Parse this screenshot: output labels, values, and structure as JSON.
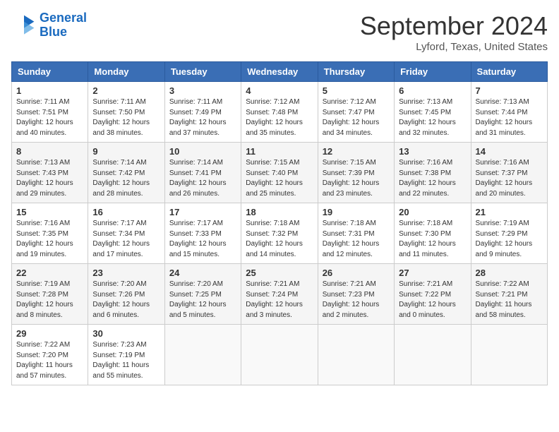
{
  "header": {
    "logo_line1": "General",
    "logo_line2": "Blue",
    "month": "September 2024",
    "location": "Lyford, Texas, United States"
  },
  "weekdays": [
    "Sunday",
    "Monday",
    "Tuesday",
    "Wednesday",
    "Thursday",
    "Friday",
    "Saturday"
  ],
  "weeks": [
    [
      {
        "day": "1",
        "info": "Sunrise: 7:11 AM\nSunset: 7:51 PM\nDaylight: 12 hours\nand 40 minutes."
      },
      {
        "day": "2",
        "info": "Sunrise: 7:11 AM\nSunset: 7:50 PM\nDaylight: 12 hours\nand 38 minutes."
      },
      {
        "day": "3",
        "info": "Sunrise: 7:11 AM\nSunset: 7:49 PM\nDaylight: 12 hours\nand 37 minutes."
      },
      {
        "day": "4",
        "info": "Sunrise: 7:12 AM\nSunset: 7:48 PM\nDaylight: 12 hours\nand 35 minutes."
      },
      {
        "day": "5",
        "info": "Sunrise: 7:12 AM\nSunset: 7:47 PM\nDaylight: 12 hours\nand 34 minutes."
      },
      {
        "day": "6",
        "info": "Sunrise: 7:13 AM\nSunset: 7:45 PM\nDaylight: 12 hours\nand 32 minutes."
      },
      {
        "day": "7",
        "info": "Sunrise: 7:13 AM\nSunset: 7:44 PM\nDaylight: 12 hours\nand 31 minutes."
      }
    ],
    [
      {
        "day": "8",
        "info": "Sunrise: 7:13 AM\nSunset: 7:43 PM\nDaylight: 12 hours\nand 29 minutes."
      },
      {
        "day": "9",
        "info": "Sunrise: 7:14 AM\nSunset: 7:42 PM\nDaylight: 12 hours\nand 28 minutes."
      },
      {
        "day": "10",
        "info": "Sunrise: 7:14 AM\nSunset: 7:41 PM\nDaylight: 12 hours\nand 26 minutes."
      },
      {
        "day": "11",
        "info": "Sunrise: 7:15 AM\nSunset: 7:40 PM\nDaylight: 12 hours\nand 25 minutes."
      },
      {
        "day": "12",
        "info": "Sunrise: 7:15 AM\nSunset: 7:39 PM\nDaylight: 12 hours\nand 23 minutes."
      },
      {
        "day": "13",
        "info": "Sunrise: 7:16 AM\nSunset: 7:38 PM\nDaylight: 12 hours\nand 22 minutes."
      },
      {
        "day": "14",
        "info": "Sunrise: 7:16 AM\nSunset: 7:37 PM\nDaylight: 12 hours\nand 20 minutes."
      }
    ],
    [
      {
        "day": "15",
        "info": "Sunrise: 7:16 AM\nSunset: 7:35 PM\nDaylight: 12 hours\nand 19 minutes."
      },
      {
        "day": "16",
        "info": "Sunrise: 7:17 AM\nSunset: 7:34 PM\nDaylight: 12 hours\nand 17 minutes."
      },
      {
        "day": "17",
        "info": "Sunrise: 7:17 AM\nSunset: 7:33 PM\nDaylight: 12 hours\nand 15 minutes."
      },
      {
        "day": "18",
        "info": "Sunrise: 7:18 AM\nSunset: 7:32 PM\nDaylight: 12 hours\nand 14 minutes."
      },
      {
        "day": "19",
        "info": "Sunrise: 7:18 AM\nSunset: 7:31 PM\nDaylight: 12 hours\nand 12 minutes."
      },
      {
        "day": "20",
        "info": "Sunrise: 7:18 AM\nSunset: 7:30 PM\nDaylight: 12 hours\nand 11 minutes."
      },
      {
        "day": "21",
        "info": "Sunrise: 7:19 AM\nSunset: 7:29 PM\nDaylight: 12 hours\nand 9 minutes."
      }
    ],
    [
      {
        "day": "22",
        "info": "Sunrise: 7:19 AM\nSunset: 7:28 PM\nDaylight: 12 hours\nand 8 minutes."
      },
      {
        "day": "23",
        "info": "Sunrise: 7:20 AM\nSunset: 7:26 PM\nDaylight: 12 hours\nand 6 minutes."
      },
      {
        "day": "24",
        "info": "Sunrise: 7:20 AM\nSunset: 7:25 PM\nDaylight: 12 hours\nand 5 minutes."
      },
      {
        "day": "25",
        "info": "Sunrise: 7:21 AM\nSunset: 7:24 PM\nDaylight: 12 hours\nand 3 minutes."
      },
      {
        "day": "26",
        "info": "Sunrise: 7:21 AM\nSunset: 7:23 PM\nDaylight: 12 hours\nand 2 minutes."
      },
      {
        "day": "27",
        "info": "Sunrise: 7:21 AM\nSunset: 7:22 PM\nDaylight: 12 hours\nand 0 minutes."
      },
      {
        "day": "28",
        "info": "Sunrise: 7:22 AM\nSunset: 7:21 PM\nDaylight: 11 hours\nand 58 minutes."
      }
    ],
    [
      {
        "day": "29",
        "info": "Sunrise: 7:22 AM\nSunset: 7:20 PM\nDaylight: 11 hours\nand 57 minutes."
      },
      {
        "day": "30",
        "info": "Sunrise: 7:23 AM\nSunset: 7:19 PM\nDaylight: 11 hours\nand 55 minutes."
      },
      {
        "day": "",
        "info": ""
      },
      {
        "day": "",
        "info": ""
      },
      {
        "day": "",
        "info": ""
      },
      {
        "day": "",
        "info": ""
      },
      {
        "day": "",
        "info": ""
      }
    ]
  ]
}
